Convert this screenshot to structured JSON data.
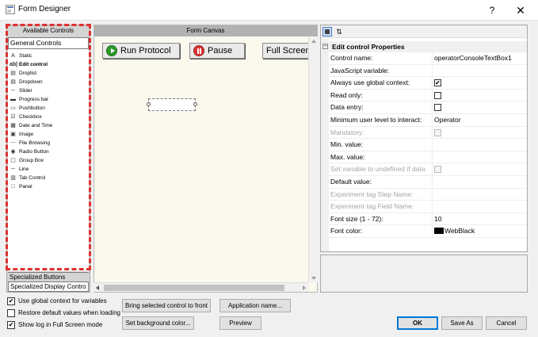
{
  "window": {
    "title": "Form Designer",
    "help": "?",
    "close": "✕"
  },
  "left_panel": {
    "header": "Available Controls",
    "tab_general": "General Controls",
    "items": [
      {
        "label": "Static",
        "icon": "A",
        "bold": false
      },
      {
        "label": "Edit control",
        "icon": "ab|",
        "bold": true
      },
      {
        "label": "Droplist",
        "icon": "▤",
        "bold": false
      },
      {
        "label": "Dropdown",
        "icon": "▤",
        "bold": false
      },
      {
        "label": "Slider",
        "icon": "─",
        "bold": false
      },
      {
        "label": "Progress bar",
        "icon": "▬",
        "bold": false
      },
      {
        "label": "Pushbutton",
        "icon": "▭",
        "bold": false
      },
      {
        "label": "Checkbox",
        "icon": "☑",
        "bold": false
      },
      {
        "label": "Date and Time",
        "icon": "▦",
        "bold": false
      },
      {
        "label": "Image",
        "icon": "▣",
        "bold": false
      },
      {
        "label": "File Browsing",
        "icon": "⋯",
        "bold": false
      },
      {
        "label": "Radio Button",
        "icon": "◉",
        "bold": false
      },
      {
        "label": "Group Box",
        "icon": "▢",
        "bold": false
      },
      {
        "label": "Line",
        "icon": "─",
        "bold": false
      },
      {
        "label": "Tab Control",
        "icon": "▥",
        "bold": false
      },
      {
        "label": "Panel",
        "icon": "□",
        "bold": false
      }
    ],
    "tab_specialized_buttons": "Specialized Buttons",
    "tab_specialized_display": "Specialized  Display Contro"
  },
  "canvas": {
    "header": "Form Canvas",
    "buttons": [
      {
        "label": "Run Protocol"
      },
      {
        "label": "Pause"
      },
      {
        "label": "Full Screen"
      }
    ]
  },
  "properties": {
    "group": "Edit control Properties",
    "rows": [
      {
        "name": "Control name:",
        "value": "operatorConsoleTextBox1",
        "type": "text",
        "disabled": false
      },
      {
        "name": "JavaScript variable:",
        "value": "",
        "type": "text",
        "disabled": false
      },
      {
        "name": "Always use global context:",
        "value": "",
        "type": "checkbox",
        "checked": true,
        "disabled": false
      },
      {
        "name": "Read only:",
        "value": "",
        "type": "checkbox",
        "checked": false,
        "disabled": false
      },
      {
        "name": "Data entry:",
        "value": "",
        "type": "checkbox",
        "checked": false,
        "disabled": false
      },
      {
        "name": "Minimum user level to interact:",
        "value": "Operator",
        "type": "text",
        "disabled": false
      },
      {
        "name": "Mandatory:",
        "value": "",
        "type": "checkbox",
        "checked": false,
        "disabled": true
      },
      {
        "name": "Min. value:",
        "value": "",
        "type": "text",
        "disabled": false
      },
      {
        "name": "Max. value:",
        "value": "",
        "type": "text",
        "disabled": false
      },
      {
        "name": "Set variable to undefined if data",
        "value": "",
        "type": "checkbox",
        "checked": false,
        "disabled": true
      },
      {
        "name": "Default value:",
        "value": "",
        "type": "text",
        "disabled": false
      },
      {
        "name": "Experiment tag Step Name:",
        "value": "",
        "type": "text",
        "disabled": true
      },
      {
        "name": "Experiment tag Field Name:",
        "value": "",
        "type": "text",
        "disabled": true
      },
      {
        "name": "Font size (1 - 72):",
        "value": "10",
        "type": "text",
        "disabled": false
      },
      {
        "name": "Font color:",
        "value": "WebBlack",
        "type": "color",
        "color": "#000000",
        "disabled": false
      }
    ]
  },
  "options": {
    "use_global": {
      "label": "Use global context for variables",
      "checked": true
    },
    "restore_defaults": {
      "label": "Restore default values when loading",
      "checked": false
    },
    "show_log": {
      "label": "Show log in Full Screen mode",
      "checked": true
    }
  },
  "buttons": {
    "bring_front": "Bring selected control to front",
    "set_background": "Set background color...",
    "app_name": "Application name...",
    "preview": "Preview",
    "ok": "OK",
    "save_as": "Save As",
    "cancel": "Cancel"
  }
}
